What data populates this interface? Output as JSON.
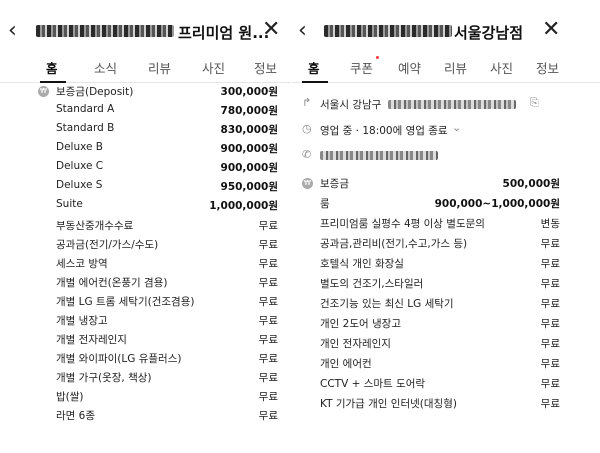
{
  "left": {
    "title": "프리미엄 원...",
    "tabs": [
      "홈",
      "소식",
      "리뷰",
      "사진",
      "정보"
    ],
    "deposit": {
      "label": "보증금(Deposit)",
      "value": "300,000원"
    },
    "rooms": [
      {
        "label": "Standard A",
        "value": "780,000원"
      },
      {
        "label": "Standard B",
        "value": "830,000원"
      },
      {
        "label": "Deluxe B",
        "value": "900,000원"
      },
      {
        "label": "Deluxe C",
        "value": "900,000원"
      },
      {
        "label": "Deluxe S",
        "value": "950,000원"
      },
      {
        "label": "Suite",
        "value": "1,000,000원"
      }
    ],
    "options": [
      {
        "label": "부동산중개수수료",
        "value": "무료"
      },
      {
        "label": "공과금(전기/가스/수도)",
        "value": "무료"
      },
      {
        "label": "세스코 방역",
        "value": "무료"
      },
      {
        "label": "개별 에어컨(온풍기 겸용)",
        "value": "무료"
      },
      {
        "label": "개별 LG 트롬 세탁기(건조겸용)",
        "value": "무료"
      },
      {
        "label": "개별 냉장고",
        "value": "무료"
      },
      {
        "label": "개별 전자레인지",
        "value": "무료"
      },
      {
        "label": "개별 와이파이(LG 유플러스)",
        "value": "무료"
      },
      {
        "label": "개별 가구(옷장, 책상)",
        "value": "무료"
      },
      {
        "label": "밥(쌀)",
        "value": "무료"
      },
      {
        "label": "라면 6종",
        "value": "무료"
      }
    ]
  },
  "right": {
    "title": "서울강남점",
    "tabs": [
      "홈",
      "쿠폰",
      "예약",
      "리뷰",
      "사진",
      "정보"
    ],
    "address": "서울시 강남구",
    "hours": "영업 중 · 18:00에 영업 종료",
    "deposit": {
      "label": "보증금",
      "value": "500,000원"
    },
    "room": {
      "label": "룸",
      "value": "900,000~1,000,000원"
    },
    "items": [
      {
        "label": "프리미엄룸 실평수 4평 이상 별도문의",
        "value": "변동"
      },
      {
        "label": "공과금,관리비(전기,수고,가스 등)",
        "value": "무료"
      },
      {
        "label": "호텔식 개인 화장실",
        "value": "무료"
      },
      {
        "label": "별도의 건조기,스타일러",
        "value": "무료"
      },
      {
        "label": "건조기능 있는 최신 LG 세탁기",
        "value": "무료"
      },
      {
        "label": "개인 2도어 냉장고",
        "value": "무료"
      },
      {
        "label": "개인 전자레인지",
        "value": "무료"
      },
      {
        "label": "개인 에어컨",
        "value": "무료"
      },
      {
        "label": "CCTV + 스마트 도어락",
        "value": "무료"
      },
      {
        "label": "KT 기가급 개인 인터넷(대칭형)",
        "value": "무료"
      }
    ]
  },
  "icons": {
    "back": "chevron-left-icon",
    "close": "close-icon",
    "deposit": "coin-icon",
    "address": "direction-arrow-icon",
    "hours": "clock-icon",
    "phone": "phone-icon",
    "copy": "copy-icon",
    "chevron": "chevron-down-icon"
  },
  "colors": {
    "coupon_dot": "#ff3b3b",
    "divider": "#e6e6e6"
  }
}
